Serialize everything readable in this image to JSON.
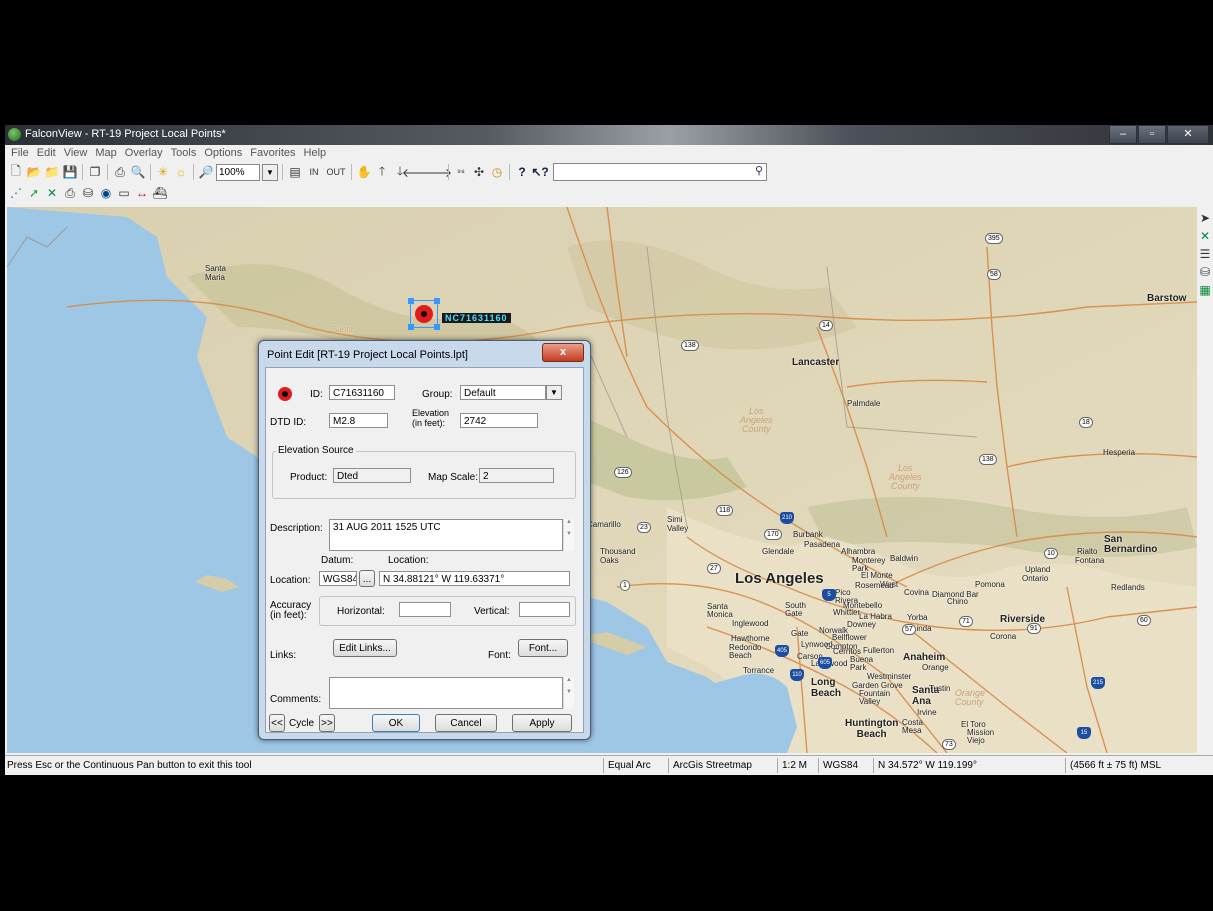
{
  "window": {
    "title": "FalconView - RT-19 Project Local Points*",
    "buttons": [
      "–",
      "▫",
      "✕"
    ]
  },
  "menu": [
    "File",
    "Edit",
    "View",
    "Map",
    "Overlay",
    "Tools",
    "Options",
    "Favorites",
    "Help"
  ],
  "toolbar": {
    "zoom": "100%",
    "in_label": "IN",
    "out_label": "OUT",
    "search_placeholder": ""
  },
  "map": {
    "marker_label": "NC71631160",
    "places": {
      "santa_maria": "Santa\nMaria",
      "lancaster": "Lancaster",
      "palmdale": "Palmdale",
      "barstow": "Barstow",
      "hesperia": "Hesperia",
      "los_angeles": "Los Angeles",
      "san_bernardino": "San\nBernardino",
      "riverside": "Riverside",
      "long_beach": "Long\nBeach",
      "santa_ana": "Santa\nAna",
      "burbank": "Burbank",
      "pasadena": "Pasadena",
      "glendale": "Glendale",
      "simi_valley": "Simi\nValley",
      "thousand_oaks": "Thousand\nOaks",
      "camarillo": "Camarillo",
      "pomona": "Pomona",
      "ontario": "Ontario",
      "upland": "Upland",
      "rialto": "Rialto",
      "fontana": "Fontana",
      "redlands": "Redlands",
      "corona": "Corona",
      "anaheim": "Anaheim",
      "orange": "Orange",
      "tustin": "Tustin",
      "irvine": "Irvine",
      "el_toro": "El Toro",
      "mission_viejo": "Mission\nViejo",
      "huntington_beach": "Huntington\nBeach",
      "costa_mesa": "Costa\nMesa",
      "torrance": "Torrance",
      "inglewood": "Inglewood",
      "hawthorne": "Hawthorne",
      "redondo": "Redondo\nBeach",
      "santa_monica": "Santa\nMonica",
      "baldwin": "Baldwin",
      "covina": "Covina",
      "chino": "Chino",
      "west_covina": "West",
      "norwalk": "Norwalk",
      "downey": "Downey",
      "compton": "Compton",
      "carson": "Carson",
      "lakewood": "Lakewood",
      "fullerton": "Fullerton",
      "cerritos": "Cerritos",
      "whittier": "Whittier",
      "la_habra": "La Habra",
      "yorba": "Yorba",
      "linda": "Linda",
      "buena_park": "Buena\nPark",
      "westminster": "Westminster",
      "garden_grove": "Garden Grove",
      "fountain_valley": "Fountain\nValley",
      "gardena": "Gate",
      "alhambra": "Alhambra",
      "monterey_park": "Monterey\nPark",
      "el_monte": "El Monte",
      "rosemead": "Rosemead",
      "pico_rivera": "Pico\nRivera",
      "montebello": "Montebello",
      "bellflower": "Bellflower",
      "diamond_bar": "Diamond Bar",
      "south_gate": "South\nGate",
      "lynwood": "Lynwood",
      "santa_label": "Santa",
      "la_county": "Los\nAngeles\nCounty",
      "la_county2": "Los\nAngeles\nCounty",
      "orange_county": "Orange\nCounty"
    },
    "shields": [
      "395",
      "58",
      "14",
      "138",
      "18",
      "138",
      "126",
      "118",
      "170",
      "210",
      "27",
      "1",
      "10",
      "30",
      "60",
      "91",
      "57",
      "71",
      "405",
      "110",
      "605",
      "5",
      "215",
      "15",
      "73",
      "1",
      "23"
    ]
  },
  "status": {
    "message": "Press Esc or the Continuous Pan button to exit this tool",
    "projection": "Equal Arc",
    "map_type": "ArcGis Streetmap",
    "scale": "1:2 M",
    "datum": "WGS84",
    "coords": "N 34.572°  W 119.199°",
    "elevation": "(4566 ft ± 75 ft) MSL"
  },
  "dialog": {
    "title": "Point Edit [RT-19 Project Local Points.lpt]",
    "close": "x",
    "id_label": "ID:",
    "id_value": "C71631160",
    "group_label": "Group:",
    "group_value": "Default",
    "dtd_label": "DTD ID:",
    "dtd_value": "M2.8",
    "elevation_label": "Elevation\n(in feet):",
    "elevation_value": "2742",
    "elev_source_title": "Elevation Source",
    "product_label": "Product:",
    "product_value": "Dted",
    "mapscale_label": "Map Scale:",
    "mapscale_value": "2",
    "description_label": "Description:",
    "description_value": "31 AUG 2011 1525 UTC",
    "datum_label": "Datum:",
    "location_header": "Location:",
    "location_label": "Location:",
    "datum_value": "WGS84",
    "datum_btn": "...",
    "location_value": "N 34.88121°  W 119.63371°",
    "accuracy_label": "Accuracy\n(in feet):",
    "horizontal_label": "Horizontal:",
    "horizontal_value": "",
    "vertical_label": "Vertical:",
    "vertical_value": "",
    "links_label": "Links:",
    "edit_links": "Edit Links...",
    "font_label": "Font:",
    "font_btn": "Font...",
    "comments_label": "Comments:",
    "comments_value": "",
    "prev": "<<",
    "cycle": "Cycle",
    "next": ">>",
    "ok": "OK",
    "cancel": "Cancel",
    "apply": "Apply"
  }
}
